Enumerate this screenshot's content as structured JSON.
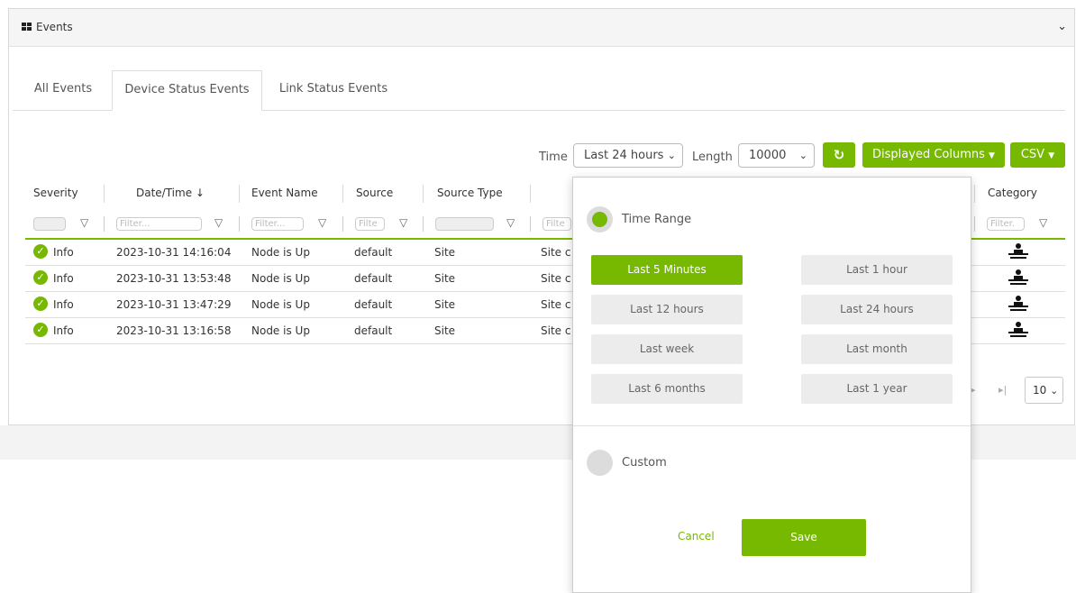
{
  "panel": {
    "title": "Events"
  },
  "tabs": [
    {
      "label": "All Events"
    },
    {
      "label": "Device Status Events"
    },
    {
      "label": "Link Status Events"
    }
  ],
  "toolbar": {
    "time_label": "Time",
    "time_value": "Last 24 hours",
    "length_label": "Length",
    "length_value": "10000",
    "displayed_columns": "Displayed Columns",
    "csv": "CSV"
  },
  "table": {
    "headers": [
      "Severity",
      "Date/Time ↓",
      "Event Name",
      "Source",
      "Source Type",
      "Category"
    ],
    "filter_placeholder": "Filter...",
    "filter_short": "Filte",
    "filter_cat": "Filter.",
    "filter_desc": "Filte",
    "rows": [
      {
        "severity": "Info",
        "datetime": "2023-10-31 14:16:04",
        "event": "Node is Up",
        "source": "default",
        "source_type": "Site",
        "desc": "Site c"
      },
      {
        "severity": "Info",
        "datetime": "2023-10-31 13:53:48",
        "event": "Node is Up",
        "source": "default",
        "source_type": "Site",
        "desc": "Site c"
      },
      {
        "severity": "Info",
        "datetime": "2023-10-31 13:47:29",
        "event": "Node is Up",
        "source": "default",
        "source_type": "Site",
        "desc": "Site c"
      },
      {
        "severity": "Info",
        "datetime": "2023-10-31 13:16:58",
        "event": "Node is Up",
        "source": "default",
        "source_type": "Site",
        "desc": "Site c"
      }
    ]
  },
  "pager": {
    "page_size": "10"
  },
  "time_dropdown": {
    "time_range_label": "Time Range",
    "ranges": [
      "Last 5 Minutes",
      "Last 1 hour",
      "Last 12 hours",
      "Last 24 hours",
      "Last week",
      "Last month",
      "Last 6 months",
      "Last 1 year"
    ],
    "selected": "Last 5 Minutes",
    "custom_label": "Custom",
    "cancel": "Cancel",
    "save": "Save"
  },
  "colors": {
    "accent": "#76b900"
  }
}
